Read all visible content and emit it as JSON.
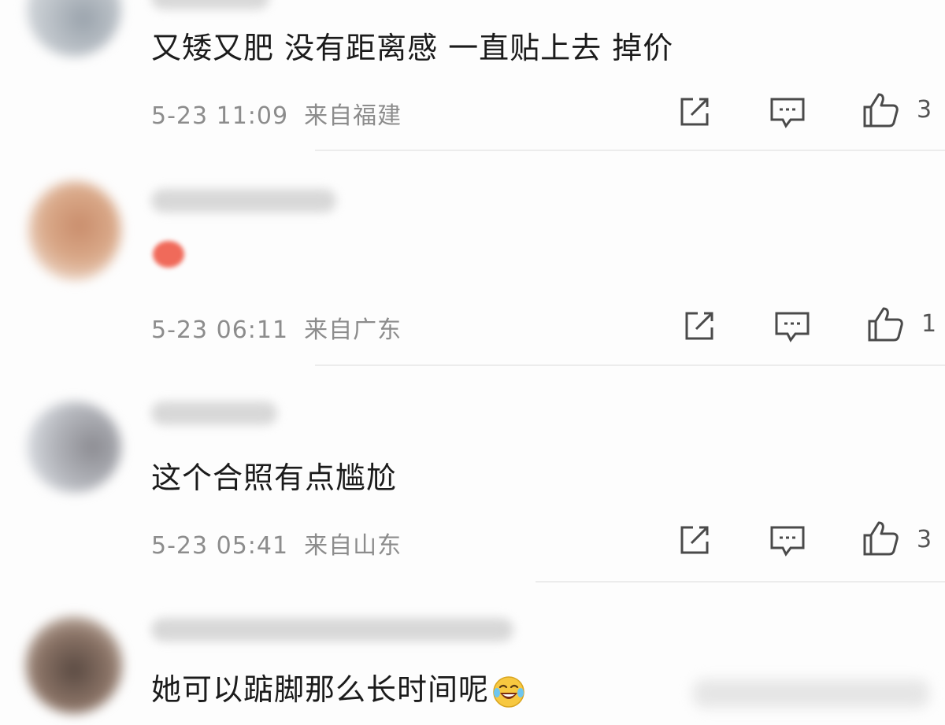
{
  "comments": [
    {
      "text": "又矮又肥 没有距离感 一直贴上去 掉价",
      "time": "5-23 11:09",
      "location": "来自福建",
      "likes": "3"
    },
    {
      "text": "",
      "time": "5-23 06:11",
      "location": "来自广东",
      "likes": "1"
    },
    {
      "text": "这个合照有点尴尬",
      "time": "5-23 05:41",
      "location": "来自山东",
      "likes": "3"
    },
    {
      "text": "她可以踮脚那么长时间呢"
    }
  ],
  "icons": {
    "share": "share-icon",
    "reply": "comment-icon",
    "like": "thumbs-up-icon",
    "emoji": "laughing-tears-emoji-icon"
  },
  "colors": {
    "text": "#1b1b1b",
    "meta": "#8c8c8c",
    "divider": "#ececec",
    "sticker": "#f06a5a"
  }
}
